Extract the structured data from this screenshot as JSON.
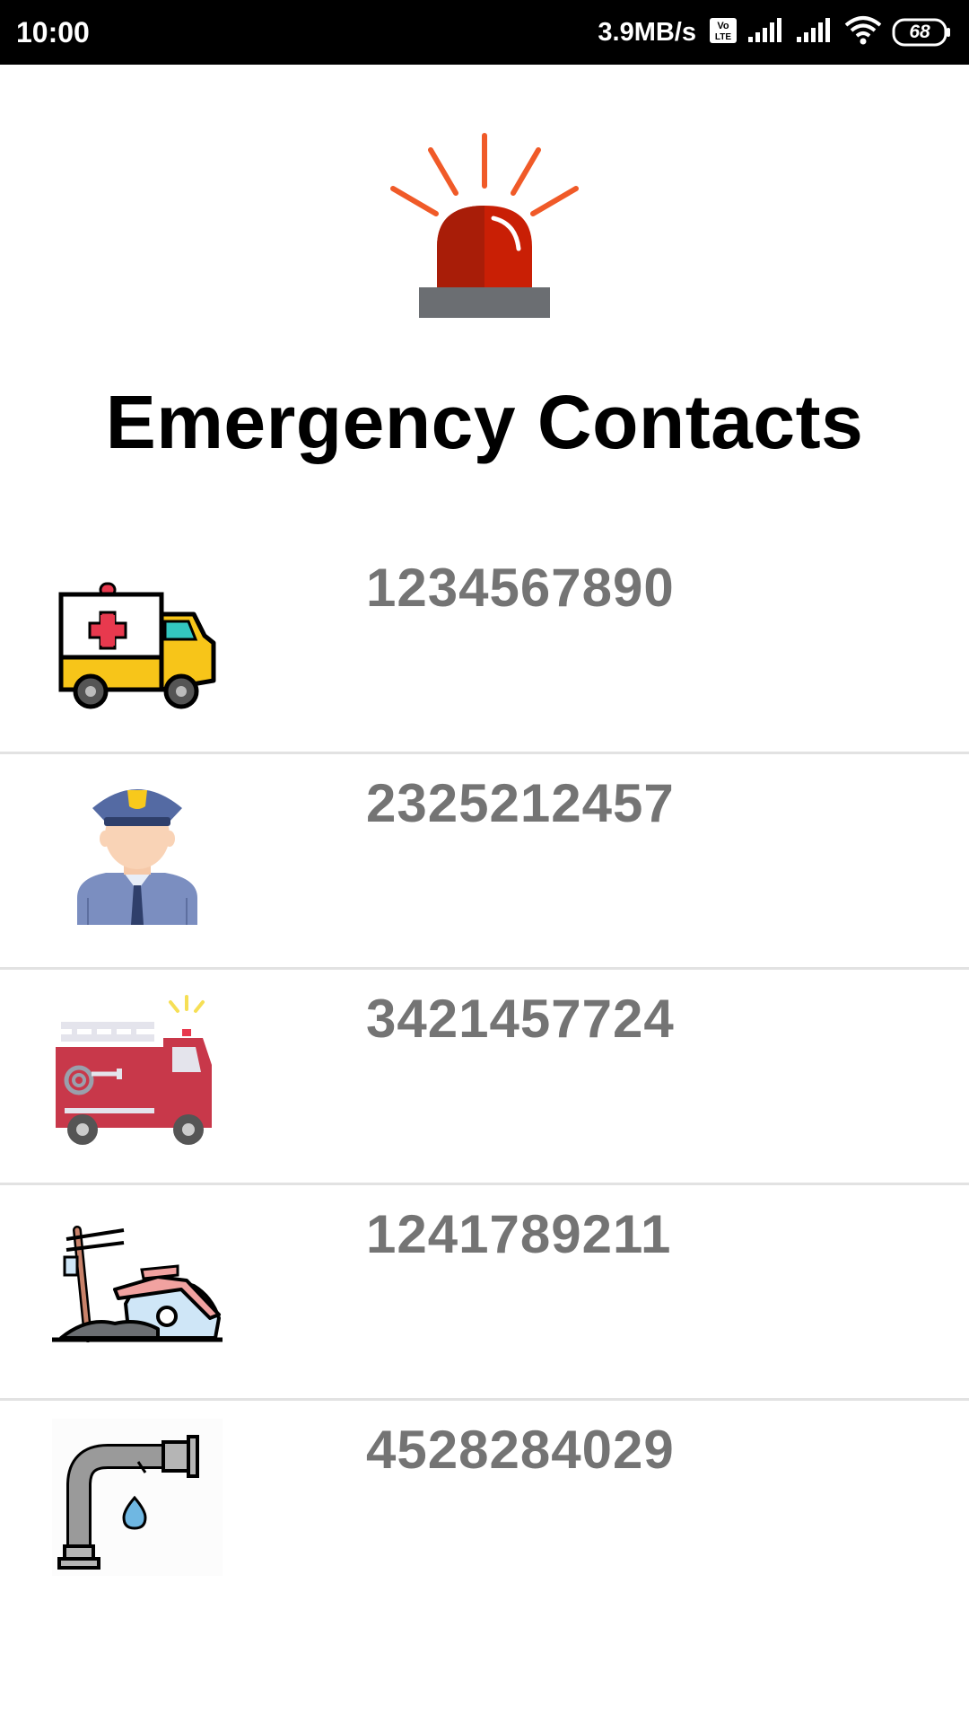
{
  "status_bar": {
    "time": "10:00",
    "speed": "3.9MB/s",
    "volte": "Vo LTE",
    "battery": "68"
  },
  "header": {
    "icon": "siren-icon",
    "title": "Emergency Contacts"
  },
  "contacts": [
    {
      "icon": "ambulance-icon",
      "number": "1234567890"
    },
    {
      "icon": "police-officer-icon",
      "number": "2325212457"
    },
    {
      "icon": "fire-truck-icon",
      "number": "3421457724"
    },
    {
      "icon": "accident-icon",
      "number": "1241789211"
    },
    {
      "icon": "leaking-pipe-icon",
      "number": "4528284029"
    }
  ],
  "colors": {
    "status_bar": "#000000",
    "number_text": "#747474",
    "divider": "#e2e2e2",
    "siren_red": "#c9200a"
  }
}
